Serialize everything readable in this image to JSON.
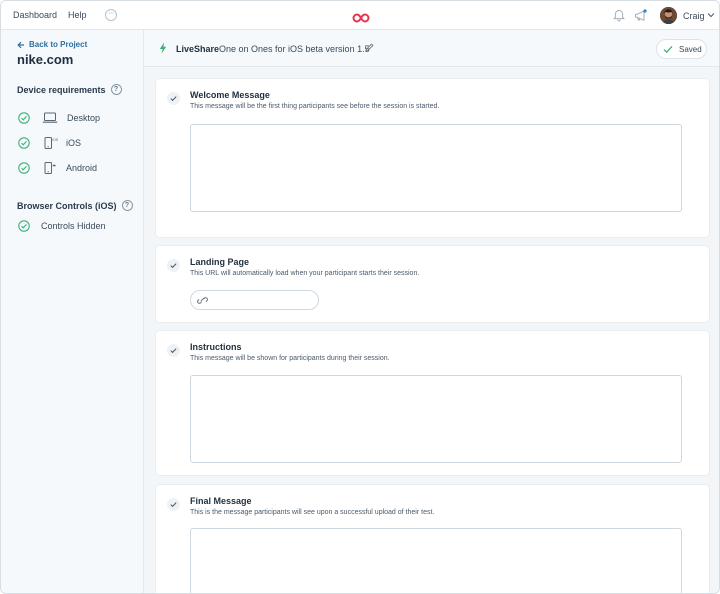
{
  "nav": {
    "dashboard": "Dashboard",
    "help": "Help",
    "more": "···",
    "user_name": "Craig"
  },
  "sidebar": {
    "back_label": "Back to Project",
    "project_name": "nike.com",
    "device_requirements": {
      "title": "Device requirements",
      "help": "?",
      "items": [
        {
          "label": "Desktop",
          "icon": "laptop-icon",
          "checked": true
        },
        {
          "label": "iOS",
          "icon": "ios-phone-icon",
          "checked": true
        },
        {
          "label": "Android",
          "icon": "android-phone-icon",
          "checked": true
        }
      ]
    },
    "browser_controls": {
      "title": "Browser Controls (iOS)",
      "help": "?",
      "items": [
        {
          "label": "Controls Hidden",
          "checked": true
        }
      ]
    }
  },
  "header": {
    "brand": "LiveShare",
    "session_name": "One on Ones for iOS beta version 1.5",
    "saved_label": "Saved"
  },
  "cards": [
    {
      "title": "Welcome Message",
      "description": "This message will be the first thing participants see before the session is started.",
      "value": ""
    },
    {
      "title": "Landing Page",
      "description": "This URL will automatically load when your participant starts their session.",
      "value": "",
      "placeholder": ""
    },
    {
      "title": "Instructions",
      "description": "This message will be shown for participants during their session.",
      "value": ""
    },
    {
      "title": "Final Message",
      "description": "This is the message participants will see upon a successful upload of their test.",
      "value": ""
    }
  ],
  "colors": {
    "accent_green": "#3fb07a",
    "link_blue": "#2f6f9f",
    "logo_red": "#e8344e"
  }
}
